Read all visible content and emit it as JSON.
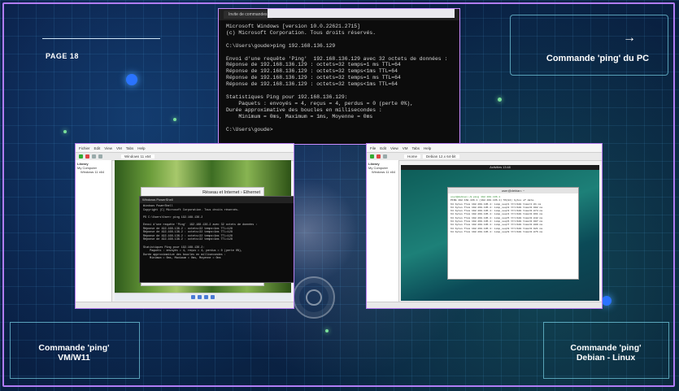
{
  "page": {
    "number": "PAGE 18"
  },
  "labels": {
    "pc": "Commande 'ping' du PC",
    "vm_line1": "Commande 'ping'",
    "vm_line2": "VM/W11",
    "debian_line1": "Commande 'ping'",
    "debian_line2": "Debian - Linux"
  },
  "colors": {
    "frame": "#b07cf5",
    "background": "#07163a",
    "accent_dot": "#2a73ff"
  },
  "cmd_window": {
    "title": "Invite de commandes",
    "lines": [
      "Microsoft Windows [version 10.0.22621.2715]",
      "(c) Microsoft Corporation. Tous droits réservés.",
      "",
      "C:\\Users\\goude>ping 192.168.136.129",
      "",
      "Envoi d'une requête 'Ping'  192.168.136.129 avec 32 octets de données :",
      "Réponse de 192.168.136.129 : octets=32 temps=1 ms TTL=64",
      "Réponse de 192.168.136.129 : octets=32 temps<1ms TTL=64",
      "Réponse de 192.168.136.129 : octets=32 temps=1 ms TTL=64",
      "Réponse de 192.168.136.129 : octets=32 temps<1ms TTL=64",
      "",
      "Statistiques Ping pour 192.168.136.129:",
      "    Paquets : envoyés = 4, reçus = 4, perdus = 0 (perte 0%),",
      "Durée approximative des boucles en millisecondes :",
      "    Minimum = 0ms, Maximum = 1ms, Moyenne = 0ms",
      "",
      "C:\\Users\\goude>"
    ]
  },
  "vm_window": {
    "menu": [
      "Fichier",
      "Edit",
      "View",
      "VM",
      "Tabs",
      "Help"
    ],
    "tab": "Windows 11 x64",
    "sidebar_title": "Library",
    "sidebar_items": [
      "My Computer",
      "Windows 11 x64"
    ],
    "explorer_title": "Réseau et Internet › Ethernet",
    "cmd_title": "Windows PowerShell",
    "cmd_lines": [
      "Windows PowerShell",
      "Copyright (C) Microsoft Corporation. Tous droits réservés.",
      "",
      "PS C:\\Users\\User> ping 192.168.136.2",
      "",
      "Envoi d'une requête 'Ping'  192.168.136.2 avec 32 octets de données :",
      "Réponse de 192.168.136.2 : octets=32 temps<1ms TTL=128",
      "Réponse de 192.168.136.2 : octets=32 temps<1ms TTL=128",
      "Réponse de 192.168.136.2 : octets=32 temps<1ms TTL=128",
      "Réponse de 192.168.136.2 : octets=32 temps<1ms TTL=128",
      "",
      "Statistiques Ping pour 192.168.136.2:",
      "    Paquets : envoyés = 4, reçus = 4, perdus = 0 (perte 0%),",
      "Durée approximative des boucles en millisecondes :",
      "    Minimum = 0ms, Maximum = 0ms, Moyenne = 0ms"
    ]
  },
  "debian_window": {
    "menu": [
      "File",
      "Edit",
      "View",
      "VM",
      "Tabs",
      "Help"
    ],
    "tabs": [
      "Home",
      "Debian 12.x 64-bit"
    ],
    "sidebar_title": "Library",
    "sidebar_items": [
      "My Computer",
      "Windows 11 x64"
    ],
    "topbar": "Activities        13:48",
    "terminal_title": "user@debian: ~",
    "terminal_prompt": "user@debian:~$ ping 192.168.136.1",
    "terminal_lines": [
      "PING 192.168.136.1 (192.168.136.1) 56(84) bytes of data.",
      "64 bytes from 192.168.136.1: icmp_seq=1 ttl=128 time=1.01 ms",
      "64 bytes from 192.168.136.1: icmp_seq=2 ttl=128 time=0.902 ms",
      "64 bytes from 192.168.136.1: icmp_seq=3 ttl=128 time=0.874 ms",
      "64 bytes from 192.168.136.1: icmp_seq=4 ttl=128 time=0.961 ms",
      "64 bytes from 192.168.136.1: icmp_seq=5 ttl=128 time=0.842 ms",
      "64 bytes from 192.168.136.1: icmp_seq=6 ttl=128 time=0.907 ms",
      "64 bytes from 192.168.136.1: icmp_seq=7 ttl=128 time=0.889 ms",
      "64 bytes from 192.168.136.1: icmp_seq=8 ttl=128 time=0.921 ms",
      "64 bytes from 192.168.136.1: icmp_seq=9 ttl=128 time=0.876 ms"
    ]
  }
}
